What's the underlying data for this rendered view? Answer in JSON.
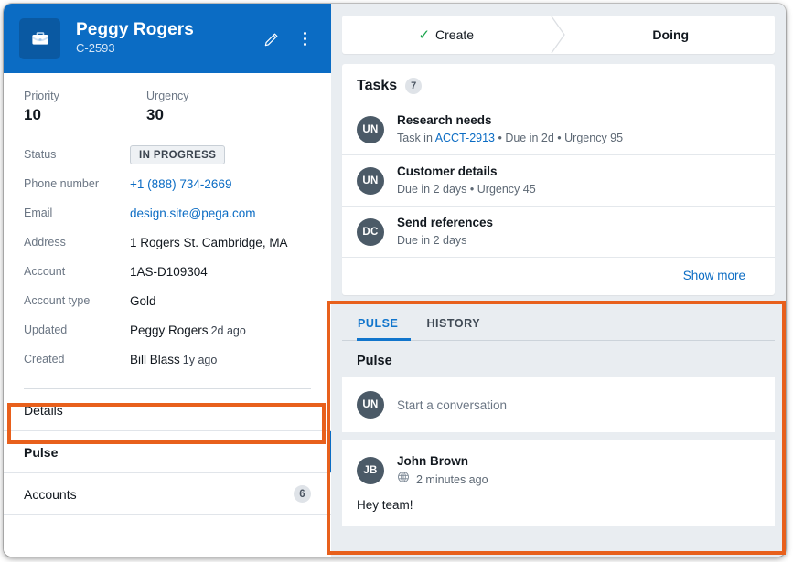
{
  "case": {
    "icon": "briefcase-icon",
    "title": "Peggy Rogers",
    "id": "C-2593",
    "edit_icon": "pencil-icon",
    "more_icon": "kebab-menu-icon"
  },
  "summary": {
    "kpis": [
      {
        "label": "Priority",
        "value": "10"
      },
      {
        "label": "Urgency",
        "value": "30"
      }
    ],
    "fields": [
      {
        "label": "Status",
        "value": "IN PROGRESS",
        "type": "badge"
      },
      {
        "label": "Phone number",
        "value": "+1 (888) 734-2669",
        "type": "link"
      },
      {
        "label": "Email",
        "value": "design.site@pega.com",
        "type": "link"
      },
      {
        "label": "Address",
        "value": "1 Rogers St. Cambridge, MA",
        "type": "text"
      },
      {
        "label": "Account",
        "value": "1AS-D109304",
        "type": "text"
      },
      {
        "label": "Account type",
        "value": "Gold",
        "type": "text"
      },
      {
        "label": "Updated",
        "value": "Peggy Rogers",
        "suffix": "2d ago",
        "type": "link"
      },
      {
        "label": "Created",
        "value": "Bill Blass",
        "suffix": "1y ago",
        "type": "link"
      }
    ]
  },
  "nav": {
    "items": [
      {
        "label": "Details",
        "count": "",
        "selected": false
      },
      {
        "label": "Pulse",
        "count": "",
        "selected": true
      },
      {
        "label": "Accounts",
        "count": "6",
        "selected": false
      }
    ]
  },
  "stepper": {
    "steps": [
      {
        "label": "Create",
        "completed": true,
        "current": false
      },
      {
        "label": "Doing",
        "completed": false,
        "current": true
      }
    ],
    "check_icon": "check-icon",
    "separator_icon": "chevron-right-icon"
  },
  "tasks": {
    "title": "Tasks",
    "count": "7",
    "show_more_label": "Show more",
    "items": [
      {
        "initials": "UN",
        "name": "Research needs",
        "meta_prefix": "Task in ",
        "meta_link": "ACCT-2913",
        "meta_suffix": " • Due in 2d • Urgency 95"
      },
      {
        "initials": "UN",
        "name": "Customer details",
        "meta_prefix": "Due in 2 days • Urgency 45",
        "meta_link": "",
        "meta_suffix": ""
      },
      {
        "initials": "DC",
        "name": "Send references",
        "meta_prefix": "Due in 2 days",
        "meta_link": "",
        "meta_suffix": ""
      }
    ]
  },
  "pulse": {
    "tabs": [
      {
        "label": "PULSE",
        "active": true
      },
      {
        "label": "HISTORY",
        "active": false
      }
    ],
    "heading": "Pulse",
    "composer": {
      "initials": "UN",
      "placeholder": "Start a conversation"
    },
    "posts": [
      {
        "initials": "JB",
        "author": "John Brown",
        "visibility_icon": "globe-icon",
        "time": "2 minutes ago",
        "body": "Hey team!"
      }
    ]
  },
  "colors": {
    "header_blue": "#0b6cc4",
    "link_blue": "#0b6cc4",
    "accent_blue": "#1175cc",
    "highlight_orange": "#e8601c",
    "avatar_gray": "#4b5a67",
    "check_green": "#17a34a",
    "panel_bg": "#e9edf1"
  }
}
